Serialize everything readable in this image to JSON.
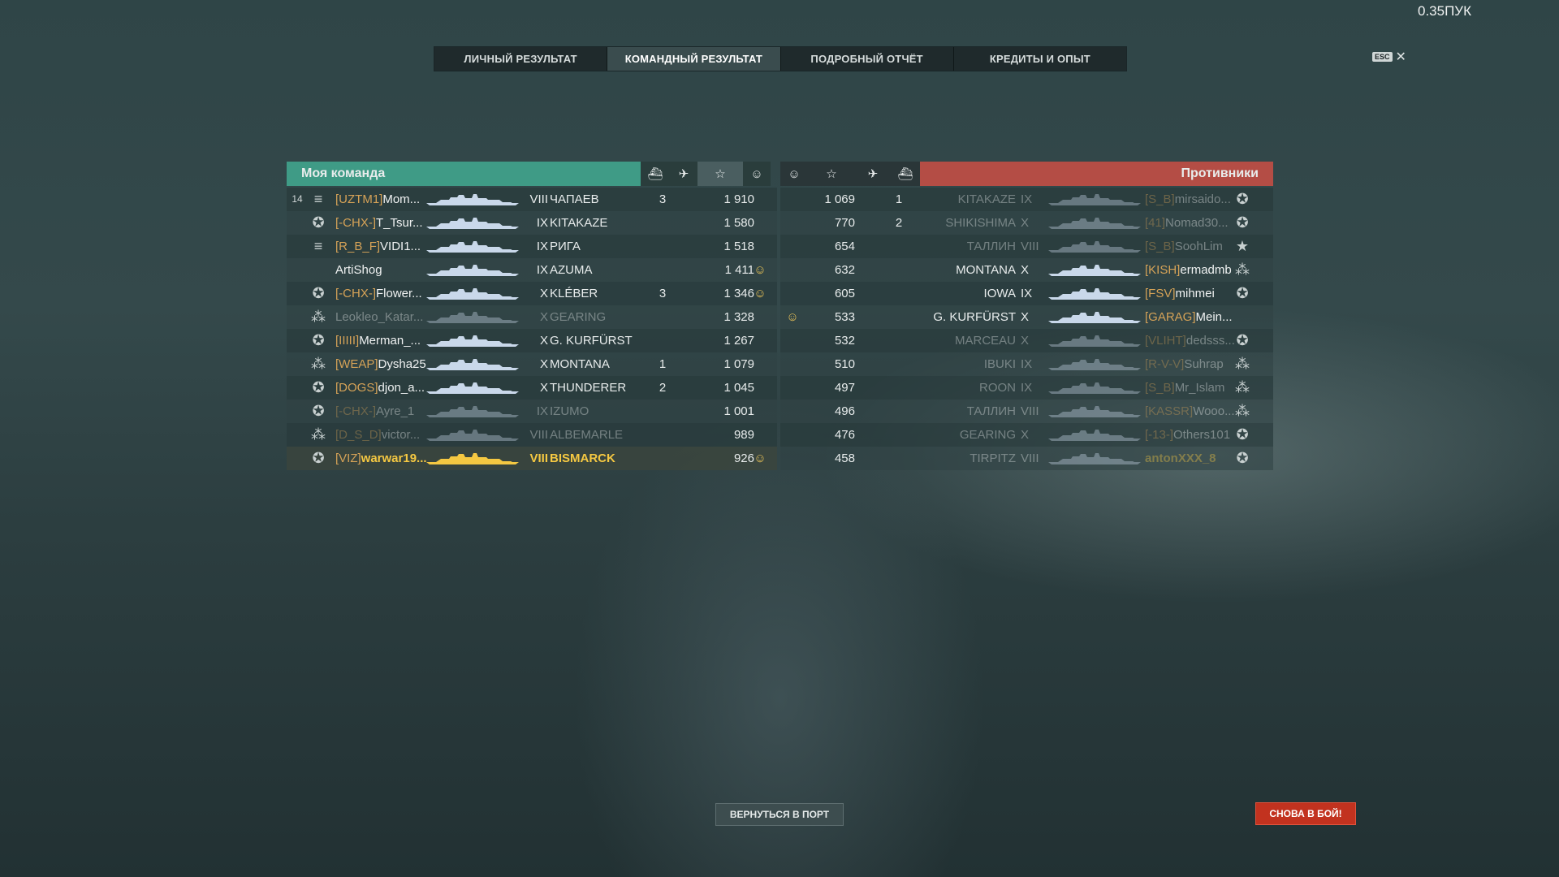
{
  "version": "0.35ПУК",
  "tabs": [
    {
      "label": "ЛИЧНЫЙ РЕЗУЛЬТАТ",
      "active": false
    },
    {
      "label": "КОМАНДНЫЙ РЕЗУЛЬТАТ",
      "active": true
    },
    {
      "label": "ПОДРОБНЫЙ ОТЧЁТ",
      "active": false
    },
    {
      "label": "КРЕДИТЫ И ОПЫТ",
      "active": false
    }
  ],
  "esc_label": "ESC",
  "teams": {
    "my_team": "Моя команда",
    "enemies": "Противники"
  },
  "colors": {
    "my_team_header": "#3f9b86",
    "enemy_header": "#b44d45",
    "clan_tag": "#d5a257",
    "highlight_player": "#f5c842",
    "battle_button": "#c2321f"
  },
  "my_rows": [
    {
      "rank": "14",
      "emblem": "stripes-icon",
      "clan": "[UZTM1]",
      "name": "Mom...",
      "tier": "VIII",
      "ship": "ЧАПАЕВ",
      "kills": "3",
      "flags": "",
      "score": "1 910",
      "icon": "",
      "dim": false,
      "me": false
    },
    {
      "rank": "",
      "emblem": "star-badge-icon",
      "clan": "[-CHX-]",
      "name": "T_Tsur...",
      "tier": "IX",
      "ship": "KITAKAZE",
      "kills": "",
      "flags": "",
      "score": "1 580",
      "icon": "",
      "dim": false,
      "me": false
    },
    {
      "rank": "",
      "emblem": "stripes-icon",
      "clan": "[R_B_F]",
      "name": "VIDI1...",
      "tier": "IX",
      "ship": "РИГА",
      "kills": "",
      "flags": "",
      "score": "1 518",
      "icon": "",
      "dim": false,
      "me": false
    },
    {
      "rank": "",
      "emblem": "",
      "clan": "",
      "name": "ArtiShog",
      "tier": "IX",
      "ship": "AZUMA",
      "kills": "",
      "flags": "",
      "score": "1 411",
      "icon": "☺",
      "dim": false,
      "me": false
    },
    {
      "rank": "",
      "emblem": "star-badge-icon",
      "clan": "[-CHX-]",
      "name": "Flower...",
      "tier": "X",
      "ship": "KLÉBER",
      "kills": "3",
      "flags": "",
      "score": "1 346",
      "icon": "☺",
      "dim": false,
      "me": false
    },
    {
      "rank": "",
      "emblem": "star-cluster-icon",
      "clan": "",
      "name": "Leokleo_Katar...",
      "tier": "X",
      "ship": "GEARING",
      "kills": "",
      "flags": "",
      "score": "1 328",
      "icon": "",
      "dim": true,
      "me": false
    },
    {
      "rank": "",
      "emblem": "star-badge-icon",
      "clan": "[IIIII]",
      "name": "Merman_...",
      "tier": "X",
      "ship": "G. KURFÜRST",
      "kills": "",
      "flags": "",
      "score": "1 267",
      "icon": "",
      "dim": false,
      "me": false
    },
    {
      "rank": "",
      "emblem": "star-cluster-icon",
      "clan": "[WEAP]",
      "name": "Dysha25",
      "tier": "X",
      "ship": "MONTANA",
      "kills": "1",
      "flags": "",
      "score": "1 079",
      "icon": "",
      "dim": false,
      "me": false
    },
    {
      "rank": "",
      "emblem": "star-badge-icon",
      "clan": "[DOGS]",
      "name": "djon_a...",
      "tier": "X",
      "ship": "THUNDERER",
      "kills": "2",
      "flags": "",
      "score": "1 045",
      "icon": "",
      "dim": false,
      "me": false
    },
    {
      "rank": "",
      "emblem": "star-badge-icon",
      "clan": "[-CHX-]",
      "name": "Ayre_1",
      "tier": "IX",
      "ship": "IZUMO",
      "kills": "",
      "flags": "",
      "score": "1 001",
      "icon": "",
      "dim": true,
      "me": false
    },
    {
      "rank": "",
      "emblem": "star-cluster-icon",
      "clan": "[D_S_D]",
      "name": "victor...",
      "tier": "VIII",
      "ship": "ALBEMARLE",
      "kills": "",
      "flags": "",
      "score": "989",
      "icon": "",
      "dim": true,
      "me": false
    },
    {
      "rank": "",
      "emblem": "star-badge-icon",
      "clan": "[VIZ]",
      "name": "warwar19...",
      "tier": "VIII",
      "ship": "BISMARCK",
      "kills": "",
      "flags": "",
      "score": "926",
      "icon": "☺",
      "dim": false,
      "me": true
    }
  ],
  "enemy_rows": [
    {
      "icon": "",
      "score": "1 069",
      "flags": "",
      "kills": "1",
      "ship": "KITAKAZE",
      "tier": "IX",
      "clan": "[S_B]",
      "name": "mirsaido...",
      "emblem": "star-badge-icon",
      "dim": true
    },
    {
      "icon": "",
      "score": "770",
      "flags": "",
      "kills": "2",
      "ship": "SHIKISHIMA",
      "tier": "X",
      "clan": "[41]",
      "name": "Nomad30...",
      "emblem": "star-badge-icon",
      "dim": true
    },
    {
      "icon": "",
      "score": "654",
      "flags": "",
      "kills": "",
      "ship": "ТАЛЛИН",
      "tier": "VIII",
      "clan": "[S_B]",
      "name": "SoohLim",
      "emblem": "star-small-icon",
      "dim": true
    },
    {
      "icon": "",
      "score": "632",
      "flags": "",
      "kills": "",
      "ship": "MONTANA",
      "tier": "X",
      "clan": "[KISH]",
      "name": "ermadmb",
      "emblem": "star-cluster-icon",
      "dim": false
    },
    {
      "icon": "",
      "score": "605",
      "flags": "",
      "kills": "",
      "ship": "IOWA",
      "tier": "IX",
      "clan": "[FSV]",
      "name": "mihmei",
      "emblem": "star-badge-icon",
      "dim": false
    },
    {
      "icon": "☺",
      "score": "533",
      "flags": "",
      "kills": "",
      "ship": "G. KURFÜRST",
      "tier": "X",
      "clan": "[GARAG]",
      "name": "Mein...",
      "emblem": "",
      "dim": false
    },
    {
      "icon": "",
      "score": "532",
      "flags": "",
      "kills": "",
      "ship": "MARCEAU",
      "tier": "X",
      "clan": "[VLIHT]",
      "name": "dedsss...",
      "emblem": "star-badge-icon",
      "dim": true
    },
    {
      "icon": "",
      "score": "510",
      "flags": "",
      "kills": "",
      "ship": "IBUKI",
      "tier": "IX",
      "clan": "[R-V-V]",
      "name": "Suhrap",
      "emblem": "star-cluster-icon",
      "dim": true
    },
    {
      "icon": "",
      "score": "497",
      "flags": "",
      "kills": "",
      "ship": "ROON",
      "tier": "IX",
      "clan": "[S_B]",
      "name": "Mr_Islam",
      "emblem": "star-cluster-icon",
      "dim": true
    },
    {
      "icon": "",
      "score": "496",
      "flags": "",
      "kills": "",
      "ship": "ТАЛЛИН",
      "tier": "VIII",
      "clan": "[KASSR]",
      "name": "Wooo...",
      "emblem": "star-cluster-icon",
      "dim": true
    },
    {
      "icon": "",
      "score": "476",
      "flags": "",
      "kills": "",
      "ship": "GEARING",
      "tier": "X",
      "clan": "[-13-]",
      "name": "Others101",
      "emblem": "star-badge-icon",
      "dim": true
    },
    {
      "icon": "",
      "score": "458",
      "flags": "",
      "kills": "",
      "ship": "TIRPITZ",
      "tier": "VIII",
      "clan": "",
      "name": "antonXXX_8",
      "emblem": "star-badge-icon",
      "dim": true
    }
  ],
  "buttons": {
    "port": "ВЕРНУТЬСЯ В ПОРТ",
    "battle": "СНОВА В БОЙ!"
  }
}
